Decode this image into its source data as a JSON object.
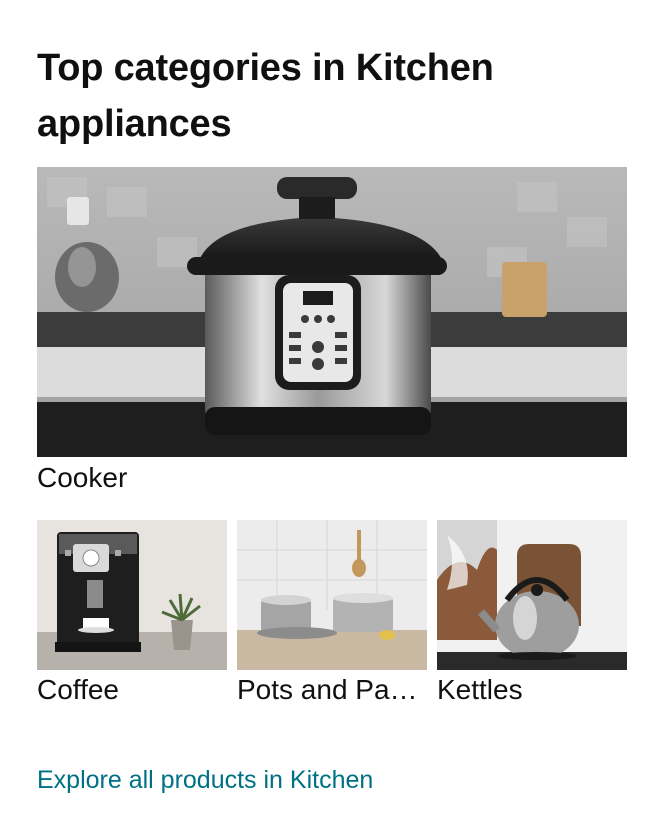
{
  "card": {
    "title": "Top categories in Kitchen appliances",
    "hero": {
      "label": "Cooker",
      "image": "pressure-cooker-photo"
    },
    "tiles": [
      {
        "label": "Coffee",
        "image": "coffee-machine-photo"
      },
      {
        "label": "Pots and Pa…",
        "image": "cookware-pots-photo"
      },
      {
        "label": "Kettles",
        "image": "steel-kettle-photo"
      }
    ],
    "explore_link": "Explore all products in Kitchen"
  }
}
